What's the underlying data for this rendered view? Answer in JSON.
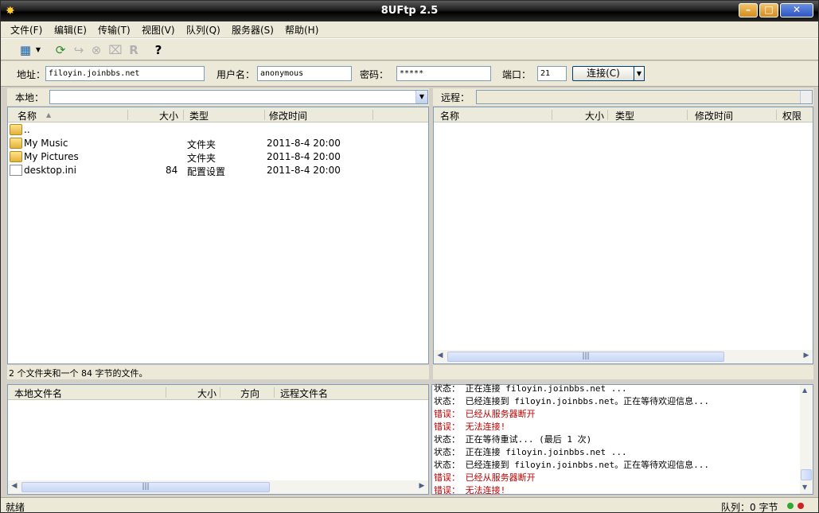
{
  "window": {
    "title": "8UFtp 2.5",
    "app_icon": "app-logo-icon"
  },
  "menu": [
    "文件(F)",
    "编辑(E)",
    "传输(T)",
    "视图(V)",
    "队列(Q)",
    "服务器(S)",
    "帮助(H)"
  ],
  "toolbar": {
    "icons": [
      "site-manager-icon",
      "dropdown-icon",
      "refresh-icon",
      "process-queue-icon",
      "cancel-icon",
      "disconnect-icon",
      "reconnect-icon",
      "help-icon"
    ],
    "help_glyph": "?",
    "reconnect_glyph": "R"
  },
  "connect": {
    "address_label": "地址：",
    "address_value": "filoyin.joinbbs.net",
    "user_label": "用户名：",
    "user_value": "anonymous",
    "password_label": "密码：",
    "password_value": "*****",
    "port_label": "端口：",
    "port_value": "21",
    "connect_button": "连接(C)"
  },
  "local": {
    "path_label": "本地：",
    "columns": [
      "名称",
      "大小",
      "类型",
      "修改时间"
    ],
    "rows": [
      {
        "name": "..",
        "size": "",
        "type": "",
        "modified": "",
        "icon": "folder-icon"
      },
      {
        "name": "My Music",
        "size": "",
        "type": "文件夹",
        "modified": "2011-8-4 20:00",
        "icon": "folder-icon"
      },
      {
        "name": "My Pictures",
        "size": "",
        "type": "文件夹",
        "modified": "2011-8-4 20:00",
        "icon": "folder-icon"
      },
      {
        "name": "desktop.ini",
        "size": "84",
        "type": "配置设置",
        "modified": "2011-8-4 20:00",
        "icon": "config-file-icon"
      }
    ],
    "status": "2 个文件夹和一个 84 字节的文件。"
  },
  "remote": {
    "path_label": "远程：",
    "columns": [
      "名称",
      "大小",
      "类型",
      "修改时间",
      "权限"
    ]
  },
  "queue": {
    "columns": [
      "本地文件名",
      "大小",
      "方向",
      "远程文件名"
    ]
  },
  "log": [
    {
      "label": "状态：",
      "text": "正在连接 filoyin.joinbbs.net ...",
      "kind": "status"
    },
    {
      "label": "状态：",
      "text": "已经连接到 filoyin.joinbbs.net。正在等待欢迎信息...",
      "kind": "status"
    },
    {
      "label": "错误：",
      "text": "已经从服务器断开",
      "kind": "error"
    },
    {
      "label": "错误：",
      "text": "无法连接!",
      "kind": "error"
    },
    {
      "label": "状态：",
      "text": "正在等待重试... (最后 1 次)",
      "kind": "status"
    },
    {
      "label": "状态：",
      "text": "正在连接 filoyin.joinbbs.net ...",
      "kind": "status"
    },
    {
      "label": "状态：",
      "text": "已经连接到 filoyin.joinbbs.net。正在等待欢迎信息...",
      "kind": "status"
    },
    {
      "label": "错误：",
      "text": "已经从服务器断开",
      "kind": "error"
    },
    {
      "label": "错误：",
      "text": "无法连接!",
      "kind": "error"
    }
  ],
  "statusbar": {
    "left": "就绪",
    "queue": "队列：0 字节"
  },
  "colors": {
    "error": "#c00000",
    "led_green": "#2fa82f",
    "led_red": "#cc2222"
  }
}
